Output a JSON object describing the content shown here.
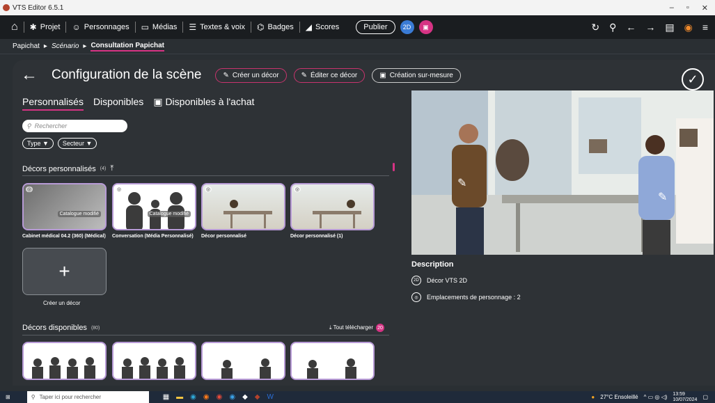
{
  "window": {
    "title": "VTS Editor 6.5.1",
    "min": "–",
    "max": "▫",
    "close": "✕"
  },
  "nav": {
    "home": "⌂",
    "items": [
      {
        "icon": "✱",
        "label": "Projet"
      },
      {
        "icon": "☺",
        "label": "Personnages"
      },
      {
        "icon": "▭",
        "label": "Médias"
      },
      {
        "icon": "☰",
        "label": "Textes & voix"
      },
      {
        "icon": "⌬",
        "label": "Badges"
      },
      {
        "icon": "◢",
        "label": "Scores"
      }
    ],
    "publish": "Publier",
    "pill1": "2D",
    "pill2": "▣",
    "right_icons": [
      "↻",
      "⚲",
      "←",
      "→",
      "▤",
      "◉",
      "≡"
    ]
  },
  "breadcrumb": {
    "root": "Papichat",
    "sep": "▸",
    "mid": "Scénario",
    "current": "Consultation Papichat"
  },
  "header": {
    "back": "←",
    "title": "Configuration de la scène",
    "btn_create": "Créer un décor",
    "btn_edit": "Éditer ce décor",
    "btn_custom": "Création sur-mesure",
    "check": "✓"
  },
  "tabs": [
    "Personnalisés",
    "Disponibles",
    "Disponibles à l'achat"
  ],
  "search": {
    "placeholder": "Rechercher",
    "icon": "⚲"
  },
  "filters": [
    "Type ▼",
    "Secteur ▼"
  ],
  "custom": {
    "title": "Décors personnalisés",
    "count": "(4)",
    "upload": "⤒",
    "cards": [
      {
        "label": "Cabinet médical 04.2 (360) (Médical)",
        "badge": "◎",
        "catalog": "Catalogue modifié"
      },
      {
        "label": "Conversation (Média Personnalisé)",
        "badge": "◎",
        "catalog": "Catalogue modifié"
      },
      {
        "label": "Décor personnalisé",
        "badge": "◎"
      },
      {
        "label": "Décor personnalisé (1)",
        "badge": "◎"
      }
    ],
    "new_label": "Créer un décor",
    "plus": "+"
  },
  "available": {
    "title": "Décors disponibles",
    "count": "(80)",
    "download_label": "⤓ Tout télécharger",
    "download_count": "20"
  },
  "description": {
    "title": "Description",
    "line1": "Décor VTS 2D",
    "line1_icon": "2D",
    "line2": "Emplacements de personnage : 2",
    "line2_icon": "◎"
  },
  "taskbar": {
    "search": "Taper ici pour rechercher",
    "weather": "27°C Ensoleillé",
    "time": "13:59",
    "date": "10/07/2024"
  }
}
